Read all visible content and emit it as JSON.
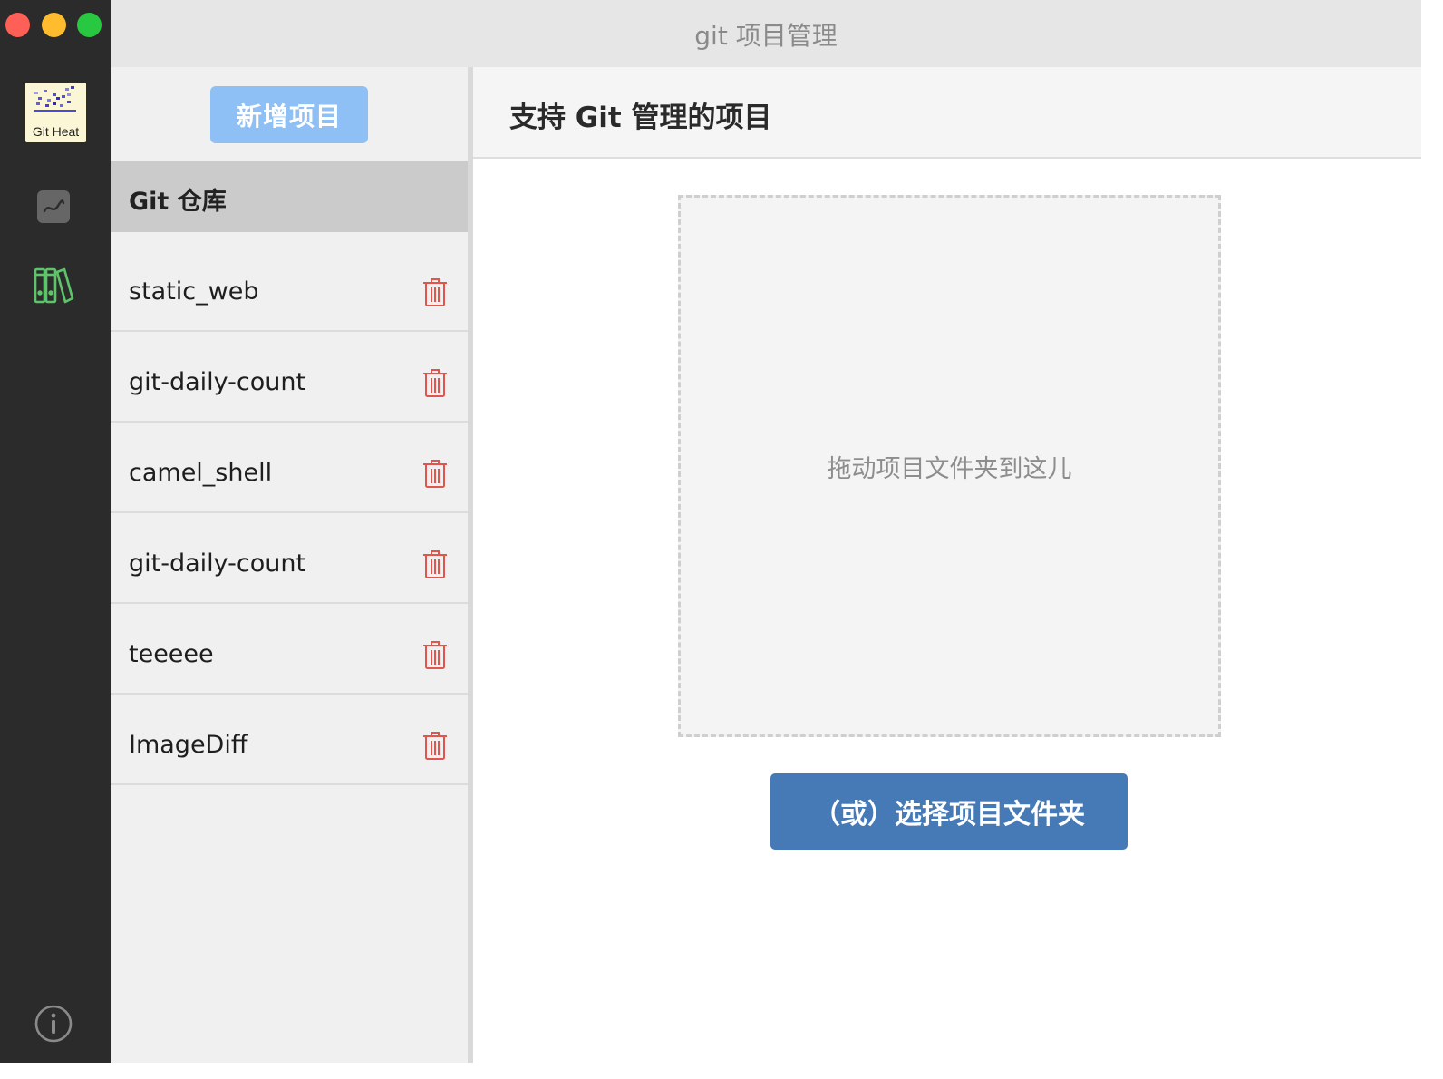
{
  "window": {
    "title": "git 项目管理"
  },
  "dock": {
    "app_logo_label": "Git Heat",
    "icons": [
      "app-logo",
      "chart-icon",
      "books-icon",
      "info-icon"
    ],
    "active_color": "#5ec46a"
  },
  "sidebar": {
    "add_button_label": "新增项目",
    "section_title": "Git 仓库",
    "projects": [
      {
        "name": "static_web"
      },
      {
        "name": "git-daily-count"
      },
      {
        "name": "camel_shell"
      },
      {
        "name": "git-daily-count"
      },
      {
        "name": "teeeee"
      },
      {
        "name": "ImageDiff"
      }
    ],
    "delete_icon_color": "#e0554d"
  },
  "main": {
    "header_title": "支持 Git 管理的项目",
    "drop_zone_text": "拖动项目文件夹到这儿",
    "choose_button_label": "（或）选择项目文件夹",
    "accent_color": "#467ab6"
  }
}
